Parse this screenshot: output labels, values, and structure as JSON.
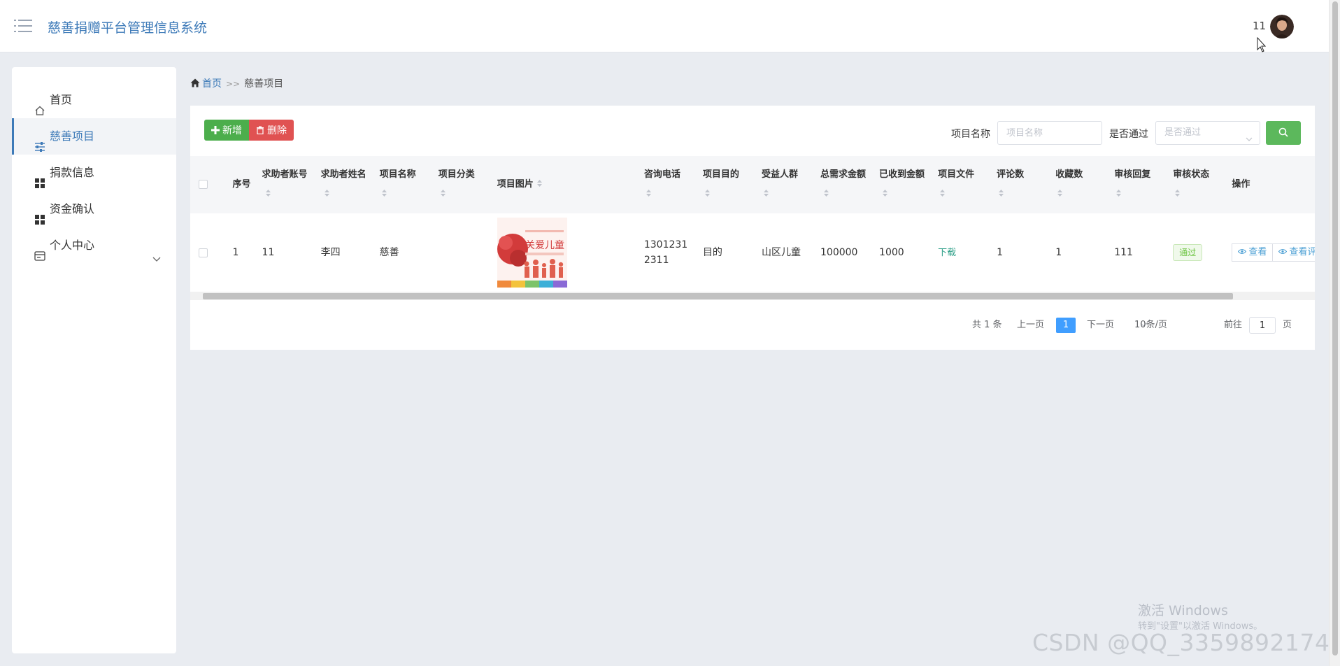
{
  "header": {
    "app_title": "慈善捐赠平台管理信息系统",
    "user_name": "11"
  },
  "sidebar": {
    "items": [
      {
        "label": "首页",
        "icon": "home-icon"
      },
      {
        "label": "慈善项目",
        "icon": "sliders-icon",
        "active": true
      },
      {
        "label": "捐款信息",
        "icon": "grid-icon"
      },
      {
        "label": "资金确认",
        "icon": "grid-icon"
      },
      {
        "label": "个人中心",
        "icon": "id-card-icon",
        "has_submenu": true
      }
    ]
  },
  "breadcrumb": {
    "home": "首页",
    "separator": ">>",
    "current": "慈善项目"
  },
  "toolbar": {
    "add_label": "新增",
    "delete_label": "删除"
  },
  "search": {
    "name_label": "项目名称",
    "name_placeholder": "项目名称",
    "approved_label": "是否通过",
    "approved_placeholder": "是否通过"
  },
  "table": {
    "columns": [
      "序号",
      "求助者账号",
      "求助者姓名",
      "项目名称",
      "项目分类",
      "项目图片",
      "咨询电话",
      "项目目的",
      "受益人群",
      "总需求金额",
      "已收到金额",
      "项目文件",
      "评论数",
      "收藏数",
      "审核回复",
      "审核状态",
      "操作"
    ],
    "rows": [
      {
        "index": "1",
        "account": "11",
        "name": "李四",
        "project_name": "慈善",
        "category": "",
        "image_caption": "关爱儿童",
        "phone": "13012312311",
        "purpose": "目的",
        "beneficiaries": "山区儿童",
        "total_needed": "100000",
        "received": "1000",
        "file_link": "下载",
        "comments": "1",
        "favorites": "1",
        "review_reply": "111",
        "status": "通过",
        "view_label": "查看",
        "view_comments_label": "查看评论"
      }
    ]
  },
  "pagination": {
    "total": "共 1 条",
    "prev": "上一页",
    "current_page": "1",
    "next": "下一页",
    "page_size": "10条/页",
    "goto_prefix": "前往",
    "goto_value": "1",
    "goto_suffix": "页"
  },
  "overlay": {
    "windows_activate": "激活 Windows",
    "windows_hint": "转到\"设置\"以激活 Windows。",
    "csdn_watermark": "CSDN @QQ_3359892174"
  },
  "colors": {
    "accent": "#3d7ab8",
    "add_button": "#4cae4c",
    "delete_button": "#e05252",
    "search_button": "#5cb85c",
    "page_active": "#409eff"
  }
}
